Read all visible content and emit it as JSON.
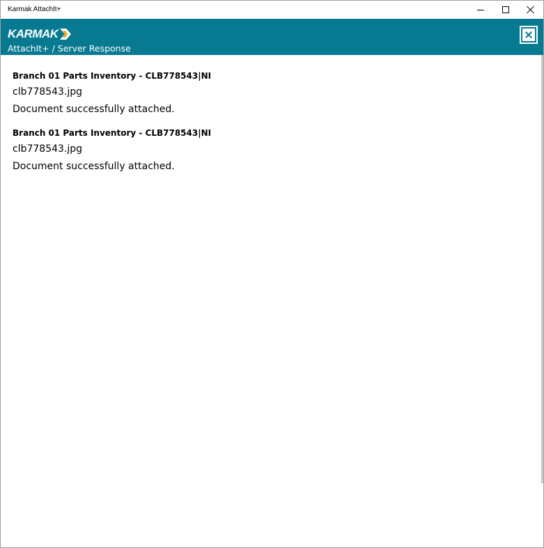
{
  "window": {
    "title": "Karmak AttachIt+"
  },
  "header": {
    "logo_text": "KARMAK",
    "subtitle": "AttachIt+ / Server Response",
    "color": "#077a92",
    "accent": "#f0a818"
  },
  "responses": [
    {
      "title": "Branch 01 Parts Inventory - CLB778543|NI",
      "file": "clb778543.jpg",
      "message": "Document successfully attached."
    },
    {
      "title": "Branch 01 Parts Inventory - CLB778543|NI",
      "file": "clb778543.jpg",
      "message": "Document successfully attached."
    }
  ]
}
